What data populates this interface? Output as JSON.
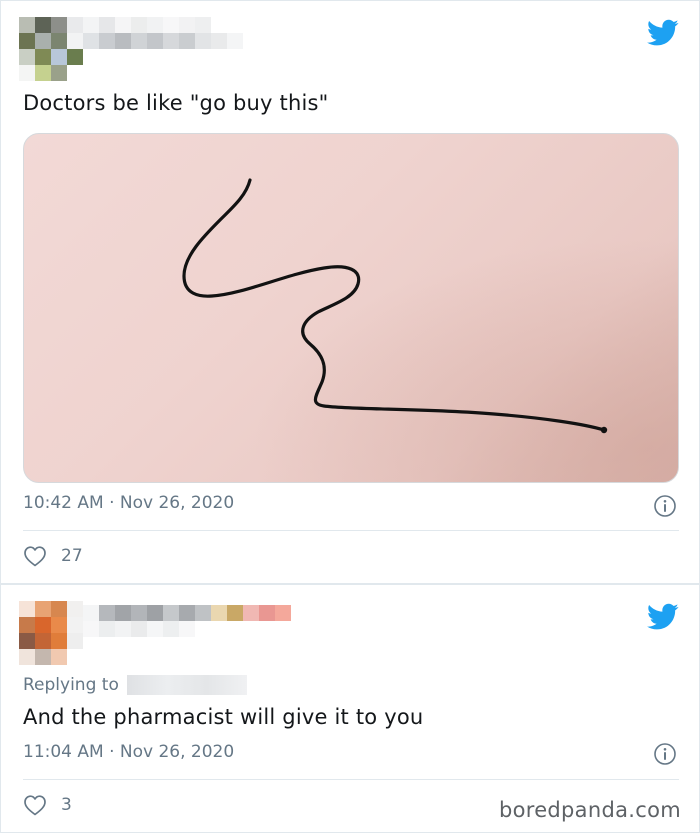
{
  "tweets": [
    {
      "text": "Doctors be like \"go buy this\"",
      "timestamp": "10:42 AM · Nov 26, 2020",
      "likes": "27",
      "has_image": true
    },
    {
      "replying_to_label": "Replying to",
      "text": "And the pharmacist will give it to you",
      "timestamp": "11:04 AM · Nov 26, 2020",
      "likes": "3"
    }
  ],
  "watermark": "boredpanda.com",
  "colors": {
    "twitter_blue": "#1da1f2",
    "secondary_text": "#657786",
    "primary_text": "#14171a",
    "divider": "#e1e8ed"
  },
  "icons": [
    "twitter-bird-icon",
    "info-icon",
    "heart-icon"
  ]
}
